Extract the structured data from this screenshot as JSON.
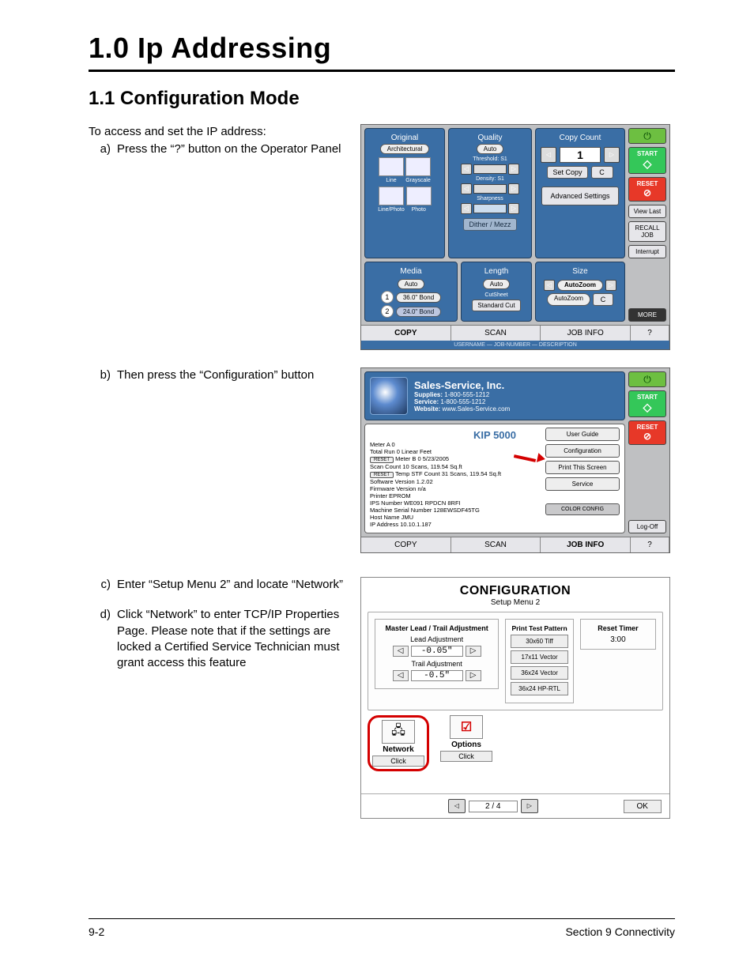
{
  "heading": {
    "chapter": "1.0   Ip Addressing",
    "section": "1.1  Configuration Mode"
  },
  "body": {
    "intro": "To access and set the IP address:",
    "step_a": "Press the “?” button on the Operator Panel",
    "step_b": "Then press the “Configuration” button",
    "step_c": "Enter “Setup Menu 2”  and locate “Network”",
    "step_d": "Click “Network” to enter TCP/IP Properties Page. Please note that if the settings are locked a Certified Service Technician must grant access this feature"
  },
  "screenshot1": {
    "top_panels": {
      "original": {
        "title": "Original",
        "mode": "Architectural",
        "thumbs": [
          "Line",
          "Grayscale",
          "Line/Photo",
          "Photo"
        ]
      },
      "quality": {
        "title": "Quality",
        "mode": "Auto",
        "rows": [
          {
            "label": "Threshold:",
            "value": "S1"
          },
          {
            "label": "Density:",
            "value": "S1"
          },
          {
            "label": "Sharpness",
            "value": ""
          }
        ],
        "button": "Dither / Mezz"
      },
      "copy_count": {
        "title": "Copy Count",
        "value": "1",
        "buttons": {
          "set_copy": "Set Copy",
          "clear": "C",
          "advanced": "Advanced Settings"
        }
      }
    },
    "mid_panels": {
      "media": {
        "title": "Media",
        "auto": "Auto",
        "rows": [
          {
            "num": "1",
            "label": "36.0\" Bond"
          },
          {
            "num": "2",
            "label": "24.0\" Bond"
          }
        ],
        "cutsheet": "CutSheet"
      },
      "length": {
        "title": "Length",
        "auto": "Auto",
        "sub": "Standard Cut"
      },
      "size": {
        "title": "Size",
        "value": "AutoZoom",
        "line2": "AutoZoom",
        "clear": "C"
      }
    },
    "right_col": {
      "start": "START",
      "reset": "RESET",
      "viewlast": "View Last",
      "recalljob": "RECALL JOB",
      "interrupt": "Interrupt",
      "more": "MORE",
      "help": "?"
    },
    "footer_tabs": [
      "COPY",
      "SCAN",
      "JOB INFO"
    ],
    "status_bar": "USERNAME   — JOB-NUMBER   — DESCRIPTION"
  },
  "screenshot2": {
    "company": {
      "name": "Sales-Service, Inc.",
      "lines": {
        "supplies_label": "Supplies:",
        "supplies": "1-800-555-1212",
        "service_label": "Service:",
        "service": "1-800-555-1212",
        "website_label": "Website:",
        "website": "www.Sales-Service.com"
      }
    },
    "device": {
      "title": "KIP 5000",
      "meter_a": "Meter A  0",
      "total_run": "Total Run  0  Linear Feet",
      "meter_b": "Meter B  0   5/23/2005",
      "scan_count": "Scan Count  10 Scans,   119.54 Sq.ft",
      "temp_stf": "Temp STF Count  31 Scans,   119.54 Sq.ft",
      "sw": "Software Version  1.2.02",
      "fw": "Firmware Version  n/a",
      "eprom": "Printer EPROM",
      "ips": "IPS Number  WE091 RPDCN 8RFI",
      "serial": "Machine Serial Number  128EWSDF45TG",
      "host": "Host Name  JMU",
      "ip": "IP Address  10.10.1.187",
      "buttons": {
        "user_guide": "User Guide",
        "configuration": "Configuration",
        "print_screen": "Print This Screen",
        "service": "Service",
        "color_config": "COLOR CONFIG"
      },
      "reset_pill": "RESET"
    },
    "right_col": {
      "start": "START",
      "reset": "RESET",
      "logoff": "Log-Off",
      "help": "?"
    },
    "footer_tabs": [
      "COPY",
      "SCAN",
      "JOB INFO"
    ]
  },
  "screenshot3": {
    "title": "CONFIGURATION",
    "subtitle": "Setup Menu 2",
    "master": {
      "heading": "Master Lead / Trail Adjustment",
      "lead_label": "Lead Adjustment",
      "lead_value": "-0.05\"",
      "trail_label": "Trail Adjustment",
      "trail_value": "-0.5\""
    },
    "print_test": {
      "heading": "Print Test Pattern",
      "buttons": [
        "30x60 Tiff",
        "17x11 Vector",
        "36x24 Vector",
        "36x24 HP-RTL"
      ]
    },
    "reset_timer": {
      "heading": "Reset Timer",
      "value": "3:00"
    },
    "quick": {
      "network": {
        "label": "Network",
        "click": "Click"
      },
      "options": {
        "label": "Options",
        "click": "Click"
      }
    },
    "pager": {
      "page": "2 / 4",
      "ok": "OK"
    }
  },
  "footer": {
    "left": "9-2",
    "right": "Section 9     Connectivity"
  }
}
